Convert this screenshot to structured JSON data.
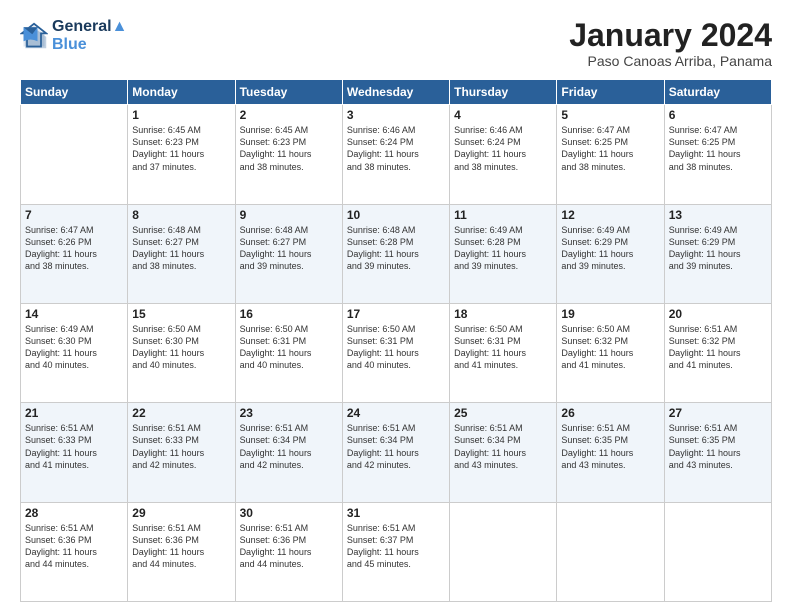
{
  "header": {
    "logo_line1": "General",
    "logo_line2": "Blue",
    "month": "January 2024",
    "location": "Paso Canoas Arriba, Panama"
  },
  "weekdays": [
    "Sunday",
    "Monday",
    "Tuesday",
    "Wednesday",
    "Thursday",
    "Friday",
    "Saturday"
  ],
  "weeks": [
    [
      {
        "day": "",
        "text": ""
      },
      {
        "day": "1",
        "text": "Sunrise: 6:45 AM\nSunset: 6:23 PM\nDaylight: 11 hours\nand 37 minutes."
      },
      {
        "day": "2",
        "text": "Sunrise: 6:45 AM\nSunset: 6:23 PM\nDaylight: 11 hours\nand 38 minutes."
      },
      {
        "day": "3",
        "text": "Sunrise: 6:46 AM\nSunset: 6:24 PM\nDaylight: 11 hours\nand 38 minutes."
      },
      {
        "day": "4",
        "text": "Sunrise: 6:46 AM\nSunset: 6:24 PM\nDaylight: 11 hours\nand 38 minutes."
      },
      {
        "day": "5",
        "text": "Sunrise: 6:47 AM\nSunset: 6:25 PM\nDaylight: 11 hours\nand 38 minutes."
      },
      {
        "day": "6",
        "text": "Sunrise: 6:47 AM\nSunset: 6:25 PM\nDaylight: 11 hours\nand 38 minutes."
      }
    ],
    [
      {
        "day": "7",
        "text": "Sunrise: 6:47 AM\nSunset: 6:26 PM\nDaylight: 11 hours\nand 38 minutes."
      },
      {
        "day": "8",
        "text": "Sunrise: 6:48 AM\nSunset: 6:27 PM\nDaylight: 11 hours\nand 38 minutes."
      },
      {
        "day": "9",
        "text": "Sunrise: 6:48 AM\nSunset: 6:27 PM\nDaylight: 11 hours\nand 39 minutes."
      },
      {
        "day": "10",
        "text": "Sunrise: 6:48 AM\nSunset: 6:28 PM\nDaylight: 11 hours\nand 39 minutes."
      },
      {
        "day": "11",
        "text": "Sunrise: 6:49 AM\nSunset: 6:28 PM\nDaylight: 11 hours\nand 39 minutes."
      },
      {
        "day": "12",
        "text": "Sunrise: 6:49 AM\nSunset: 6:29 PM\nDaylight: 11 hours\nand 39 minutes."
      },
      {
        "day": "13",
        "text": "Sunrise: 6:49 AM\nSunset: 6:29 PM\nDaylight: 11 hours\nand 39 minutes."
      }
    ],
    [
      {
        "day": "14",
        "text": "Sunrise: 6:49 AM\nSunset: 6:30 PM\nDaylight: 11 hours\nand 40 minutes."
      },
      {
        "day": "15",
        "text": "Sunrise: 6:50 AM\nSunset: 6:30 PM\nDaylight: 11 hours\nand 40 minutes."
      },
      {
        "day": "16",
        "text": "Sunrise: 6:50 AM\nSunset: 6:31 PM\nDaylight: 11 hours\nand 40 minutes."
      },
      {
        "day": "17",
        "text": "Sunrise: 6:50 AM\nSunset: 6:31 PM\nDaylight: 11 hours\nand 40 minutes."
      },
      {
        "day": "18",
        "text": "Sunrise: 6:50 AM\nSunset: 6:31 PM\nDaylight: 11 hours\nand 41 minutes."
      },
      {
        "day": "19",
        "text": "Sunrise: 6:50 AM\nSunset: 6:32 PM\nDaylight: 11 hours\nand 41 minutes."
      },
      {
        "day": "20",
        "text": "Sunrise: 6:51 AM\nSunset: 6:32 PM\nDaylight: 11 hours\nand 41 minutes."
      }
    ],
    [
      {
        "day": "21",
        "text": "Sunrise: 6:51 AM\nSunset: 6:33 PM\nDaylight: 11 hours\nand 41 minutes."
      },
      {
        "day": "22",
        "text": "Sunrise: 6:51 AM\nSunset: 6:33 PM\nDaylight: 11 hours\nand 42 minutes."
      },
      {
        "day": "23",
        "text": "Sunrise: 6:51 AM\nSunset: 6:34 PM\nDaylight: 11 hours\nand 42 minutes."
      },
      {
        "day": "24",
        "text": "Sunrise: 6:51 AM\nSunset: 6:34 PM\nDaylight: 11 hours\nand 42 minutes."
      },
      {
        "day": "25",
        "text": "Sunrise: 6:51 AM\nSunset: 6:34 PM\nDaylight: 11 hours\nand 43 minutes."
      },
      {
        "day": "26",
        "text": "Sunrise: 6:51 AM\nSunset: 6:35 PM\nDaylight: 11 hours\nand 43 minutes."
      },
      {
        "day": "27",
        "text": "Sunrise: 6:51 AM\nSunset: 6:35 PM\nDaylight: 11 hours\nand 43 minutes."
      }
    ],
    [
      {
        "day": "28",
        "text": "Sunrise: 6:51 AM\nSunset: 6:36 PM\nDaylight: 11 hours\nand 44 minutes."
      },
      {
        "day": "29",
        "text": "Sunrise: 6:51 AM\nSunset: 6:36 PM\nDaylight: 11 hours\nand 44 minutes."
      },
      {
        "day": "30",
        "text": "Sunrise: 6:51 AM\nSunset: 6:36 PM\nDaylight: 11 hours\nand 44 minutes."
      },
      {
        "day": "31",
        "text": "Sunrise: 6:51 AM\nSunset: 6:37 PM\nDaylight: 11 hours\nand 45 minutes."
      },
      {
        "day": "",
        "text": ""
      },
      {
        "day": "",
        "text": ""
      },
      {
        "day": "",
        "text": ""
      }
    ]
  ]
}
